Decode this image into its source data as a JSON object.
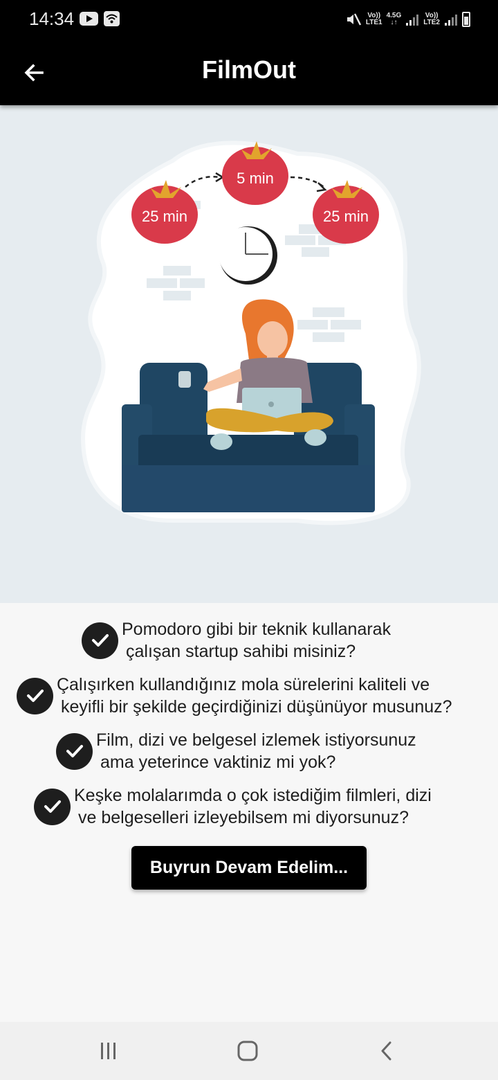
{
  "status_bar": {
    "time": "14:34",
    "sim1_top": "Vo))",
    "sim1_bottom": "LTE1",
    "network_type": "4.5G",
    "sim2_top": "Vo))",
    "sim2_bottom": "LTE2",
    "icons": [
      "youtube-icon",
      "wifi-icon",
      "mute-icon",
      "signal-icon",
      "battery-icon"
    ]
  },
  "app_bar": {
    "title": "FilmOut",
    "back_icon": "arrow-left-icon"
  },
  "hero": {
    "timer_left": "25 min",
    "timer_middle": "5 min",
    "timer_right": "25 min"
  },
  "questions": [
    {
      "line1": "Pomodoro gibi bir teknik kullanarak",
      "line2": "çalışan startup sahibi misiniz?"
    },
    {
      "line1": "Çalışırken kullandığınız mola sürelerini kaliteli ve",
      "line2": "keyifli bir şekilde geçirdiğinizi düşünüyor musunuz?"
    },
    {
      "line1": "Film, dizi ve belgesel izlemek istiyorsunuz",
      "line2": "ama yeterince vaktiniz mi yok?"
    },
    {
      "line1": "Keşke molalarımda o çok istediğim filmleri, dizi",
      "line2": "ve belgeselleri izleyebilsem mi diyorsunuz?"
    }
  ],
  "cta": {
    "label": "Buyrun Devam Edelim..."
  },
  "colors": {
    "bar_background": "#000000",
    "hero_background": "#e6ecf0",
    "tomato": "#d93a4a",
    "sofa": "#1f4663",
    "text": "#1e1e1e"
  },
  "nav_bar": {
    "icons": [
      "recent-apps-icon",
      "home-icon",
      "back-nav-icon"
    ]
  }
}
